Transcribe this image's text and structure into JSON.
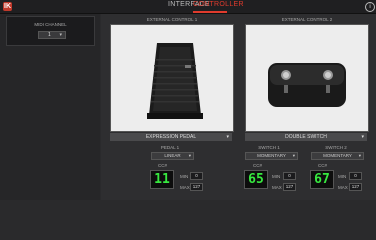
{
  "app": {
    "logo_text": "IK",
    "brand_color": "#c0392b"
  },
  "tabs": [
    {
      "label": "INTERFACE",
      "active": false
    },
    {
      "label": "CONTROLLER",
      "active": true
    }
  ],
  "info_icon": "info-icon",
  "midi": {
    "label": "MIDI CHANNEL",
    "value": "1"
  },
  "controls": [
    {
      "title": "EXTERNAL CONTROL 1",
      "device": "EXPRESSION PEDAL",
      "subs": [
        {
          "title": "PEDAL 1",
          "mode": "LINEAR",
          "cc_label": "CC#",
          "cc": "11",
          "min_label": "MIN",
          "min": "0",
          "max_label": "MAX",
          "max": "127"
        }
      ]
    },
    {
      "title": "EXTERNAL CONTROL 2",
      "device": "DOUBLE SWITCH",
      "subs": [
        {
          "title": "SWITCH 1",
          "mode": "MOMENTARY",
          "cc_label": "CC#",
          "cc": "65",
          "min_label": "MIN",
          "min": "0",
          "max_label": "MAX",
          "max": "127"
        },
        {
          "title": "SWITCH 2",
          "mode": "MOMENTARY",
          "cc_label": "CC#",
          "cc": "67",
          "min_label": "MIN",
          "min": "0",
          "max_label": "MAX",
          "max": "127"
        }
      ]
    }
  ],
  "colors": {
    "accent": "#e03b2d",
    "lcd_green": "#37e83f"
  }
}
